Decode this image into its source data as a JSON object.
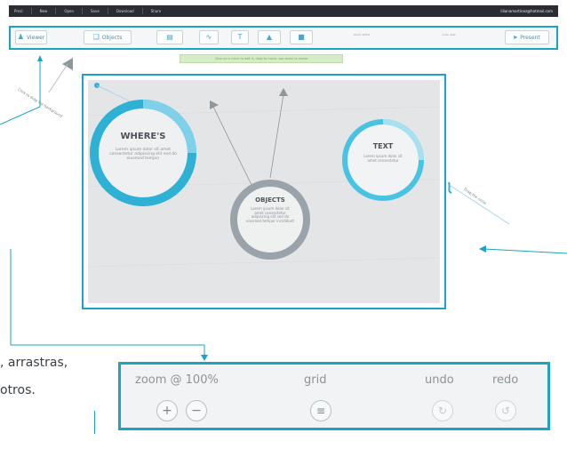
{
  "menubar": {
    "items": [
      "Prezi",
      "New",
      "Open",
      "Save",
      "Download",
      "Share"
    ],
    "email": "lilianamartinez@hotmail.com"
  },
  "toolbar": {
    "viewer_label": "Viewer",
    "objects_label": "Objects",
    "mini_left": "Zoom 100%",
    "mini_right": "undo redo",
    "present_label": "Present"
  },
  "notice": {
    "text": "Click on a circle to edit it, drag to move, use zoom to resize"
  },
  "canvas": {
    "circles": [
      {
        "title": "WHERE'S",
        "body": "Lorem ipsum dolor sit amet consectetur adipiscing elit sed do eiusmod tempor",
        "color": "#2fb1d6"
      },
      {
        "title": "OBJECTS",
        "body": "Lorem ipsum dolor sit amet consectetur adipiscing elit sed do eiusmod tempor incididunt",
        "color": "#9aa3a9"
      },
      {
        "title": "TEXT",
        "body": "Lorem ipsum dolor sit amet consectetur",
        "color": "#49c3e2"
      }
    ]
  },
  "annotations": {
    "left": "Click to drag the background",
    "right": "Drag the circle"
  },
  "fragment": {
    "line1": ", arrastras,",
    "line2": "otros."
  },
  "zoom_panel": {
    "zoom_label": "zoom @ 100%",
    "grid_label": "grid",
    "undo_label": "undo",
    "redo_label": "redo"
  },
  "colors": {
    "accent": "#1aa3c4",
    "menubar": "#2a2d31",
    "canvas_bg": "#e3e5e7"
  },
  "icons": [
    "plus-icon",
    "minus-icon",
    "grid-icon",
    "undo-icon",
    "redo-icon",
    "triangle-arrow-icon",
    "pin-icon"
  ]
}
